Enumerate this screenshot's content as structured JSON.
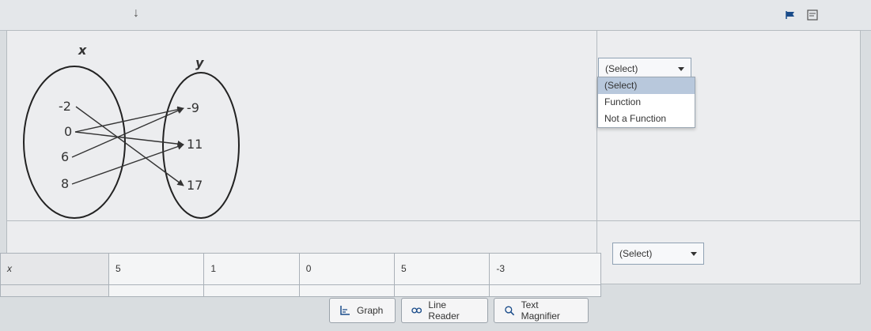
{
  "toolbar": {
    "arrow_glyph": "↓",
    "flag_icon": "flag-icon",
    "notes_icon": "notes-icon"
  },
  "question1": {
    "diagram": {
      "x_label": "x",
      "y_label": "y",
      "x_values": [
        "-2",
        "0",
        "6",
        "8"
      ],
      "y_values": [
        "-9",
        "11",
        "17"
      ],
      "mappings": [
        [
          "-2",
          "17"
        ],
        [
          "0",
          "-9"
        ],
        [
          "0",
          "11"
        ],
        [
          "6",
          "-9"
        ],
        [
          "8",
          "11"
        ]
      ]
    },
    "select": {
      "value": "(Select)",
      "open": true,
      "options": [
        "(Select)",
        "Function",
        "Not a Function"
      ]
    }
  },
  "question2": {
    "table": {
      "header": "x",
      "values": [
        "5",
        "1",
        "0",
        "5",
        "-3"
      ]
    },
    "select": {
      "value": "(Select)"
    }
  },
  "buttons": {
    "graph": "Graph",
    "line_reader": "Line Reader",
    "text_magnifier": "Text Magnifier"
  }
}
